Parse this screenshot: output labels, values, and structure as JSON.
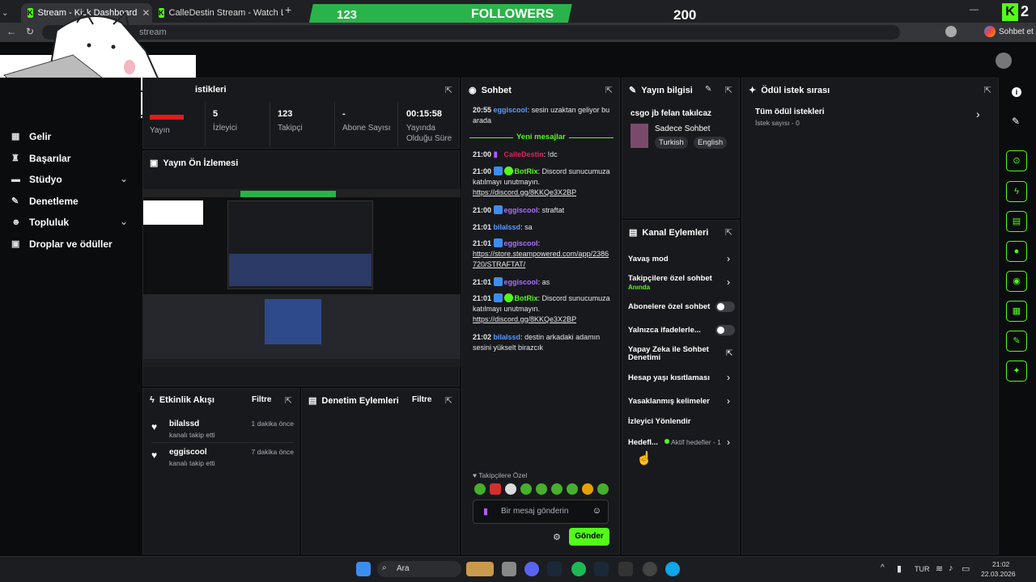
{
  "browser": {
    "tabs": [
      {
        "title": "Stream - Kick Dashboard"
      },
      {
        "title": "CalleDestin Stream - Watch Live o"
      }
    ],
    "address": "stream",
    "profile_label": "Sohbet et"
  },
  "overlay": {
    "followers_count": "123",
    "followers_label": "FOLLOWERS",
    "followers_goal": "200",
    "corner_count": "2"
  },
  "sidebar": {
    "items": [
      {
        "label": "Gelir",
        "icon": "dollar-icon"
      },
      {
        "label": "Başarılar",
        "icon": "trophy-icon"
      },
      {
        "label": "Stüdyo",
        "icon": "studio-icon"
      },
      {
        "label": "Denetleme",
        "icon": "wrench-icon"
      },
      {
        "label": "Topluluk",
        "icon": "people-icon"
      },
      {
        "label": "Droplar ve ödüller",
        "icon": "gift-icon"
      }
    ]
  },
  "stats": {
    "title_partial": "istikleri",
    "items": [
      {
        "value": "",
        "label": "Yayın"
      },
      {
        "value": "5",
        "label": "İzleyici"
      },
      {
        "value": "123",
        "label": "Takipçi"
      },
      {
        "value": "-",
        "label": "Abone Sayısı"
      },
      {
        "value": "00:15:58",
        "label": "Yayında Olduğu Süre"
      }
    ]
  },
  "preview": {
    "title": "Yayın Ön İzlemesi"
  },
  "activity": {
    "title": "Etkinlik Akışı",
    "filter": "Filtre",
    "items": [
      {
        "user": "bilalssd",
        "action": "kanalı takip etti",
        "time": "1 dakika önce"
      },
      {
        "user": "eggiscool",
        "action": "kanalı takip etti",
        "time": "7 dakika önce"
      }
    ]
  },
  "moderation": {
    "title": "Denetim Eylemleri",
    "filter": "Filtre"
  },
  "chat": {
    "title": "Sohbet",
    "new_messages": "Yeni mesajlar",
    "messages": [
      {
        "time": "20:55",
        "user": "eggiscool",
        "text": ": sesin uzaktan geliyor bu arada"
      },
      {
        "time": "21:00",
        "user": "CalleDestin",
        "text": ": !dc"
      },
      {
        "time": "21:00",
        "user": "BotRix",
        "text": ": Discord sunucumuza katılmayı unutmayın.",
        "link": "https://discord.gg/8KKQe3X2BP"
      },
      {
        "time": "21:00",
        "user": "eggiscool",
        "text": ": straftat"
      },
      {
        "time": "21:01",
        "user": "bilalssd",
        "text": ": sa"
      },
      {
        "time": "21:01",
        "user": "eggiscool",
        "text": ":",
        "link": "https://store.steampowered.com/app/2386720/STRAFTAT/"
      },
      {
        "time": "21:01",
        "user": "eggiscool",
        "text": ": as"
      },
      {
        "time": "21:01",
        "user": "BotRix",
        "text": ": Discord sunucumuza katılmayı unutmayın.",
        "link": "https://discord.gg/8KKQe3X2BP"
      },
      {
        "time": "21:02",
        "user": "bilalssd",
        "text": ": destin arkadaki adamın sesini yükselt birazcık"
      }
    ],
    "emote_header": "Takipçilere Özel",
    "input_placeholder": "Bir mesaj gönderin",
    "send_label": "Gönder"
  },
  "stream_info": {
    "title": "Yayın bilgisi",
    "stream_title": "csgo jb felan takılcaz",
    "category": "Sadece Sohbet",
    "tags": [
      "Turkish",
      "English"
    ]
  },
  "channel_actions": {
    "title": "Kanal Eylemleri",
    "items": [
      {
        "label": "Yavaş mod",
        "kind": "chevron"
      },
      {
        "label": "Takipçilere özel sohbet",
        "sub": "Anında",
        "kind": "chevron"
      },
      {
        "label": "Abonelere özel sohbet",
        "kind": "toggle"
      },
      {
        "label": "Yalnızca ifadelerle...",
        "kind": "toggle"
      },
      {
        "label": "Yapay Zeka ile Sohbet Denetimi",
        "kind": "external"
      },
      {
        "label": "Hesap yaşı kısıtlaması",
        "kind": "chevron"
      },
      {
        "label": "Yasaklanmış kelimeler",
        "kind": "chevron"
      },
      {
        "label": "İzleyici Yönlendir",
        "kind": "none"
      },
      {
        "label": "Hedefl...",
        "extra": "Aktif hedefler - 1",
        "kind": "chevron"
      }
    ]
  },
  "rewards": {
    "title": "Ödül istek sırası",
    "all": "Tüm ödül istekleri",
    "count": "İstek sayısı - 0"
  },
  "taskbar": {
    "search": "Ara",
    "lang": "TUR",
    "time": "21:02",
    "date": "22.03.2026"
  },
  "colors": {
    "accent": "#53fc18",
    "panel": "#18191c",
    "link_user": "#a970ff"
  }
}
